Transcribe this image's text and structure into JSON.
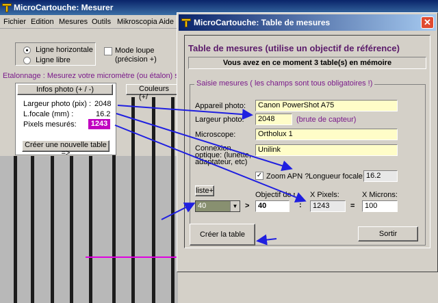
{
  "main_window": {
    "title": "MicroCartouche: Mesurer",
    "menu": [
      "Fichier",
      "Edition",
      "Mesures",
      "Outils",
      "Mikroscopia",
      "Aide"
    ],
    "line_options": {
      "horizontal": "Ligne horizontale",
      "libre": "Ligne libre",
      "selected": "horizontal"
    },
    "loupe_mode": {
      "label_line1": "Mode loupe",
      "label_line2": "(précision +)",
      "checked": false
    },
    "calibration_instruction": "Etalonnage : Mesurez votre micromètre (ou étalon) sur",
    "infos_photo_button": "Infos photo (+ / -)",
    "colors_button": "Couleurs (+/",
    "photo_info": {
      "width_label": "Largeur photo (pix) :",
      "width_value": "2048",
      "focal_label": "L.focale (mm) :",
      "focal_value": "16.2",
      "pixels_label": "Pixels mesurés:",
      "pixels_value": "1243"
    },
    "new_table_button": "Créer une nouvelle table =>"
  },
  "dialog": {
    "title": "MicroCartouche: Table de mesures",
    "close_glyph": "✕",
    "heading": "Table de mesures (utilise un objectif de référence)",
    "memory_status": "Vous avez en ce moment 3 table(s) en mémoire",
    "group_title": "Saisie mesures ( les champs sont tous obligatoires !)",
    "fields": {
      "camera_label": "Appareil photo:",
      "camera_value": "Canon PowerShot A75",
      "width_label": "Largeur photo:",
      "width_value": "2048",
      "width_hint": "(brute de capteur)",
      "microscope_label": "Microscope:",
      "microscope_value": "Ortholux 1",
      "connection_label_1": "Connexion",
      "connection_label_2": "optique: (lunette,",
      "connection_label_3": "adaptateur, etc)",
      "connection_value": "Unilink",
      "zoom_label": "Zoom APN ?",
      "zoom_checked": true,
      "focal_label": "Longueur focale:",
      "focal_value": "16.2"
    },
    "list_button": "liste+",
    "objective_select_value": "40",
    "gt_symbol": ">",
    "objective_label": "Objectif de réf.",
    "objective_value": "40",
    "colon_symbol": ":",
    "xpixels_label": "X Pixels:",
    "xpixels_value": "1243",
    "equals_symbol": "=",
    "xmicrons_label": "X Microns:",
    "xmicrons_value": "100",
    "create_button": "Créer la table",
    "exit_button": "Sortir"
  },
  "colors": {
    "annotation_arrow": "#1f1fe0",
    "magnifier_line": "#e000e0",
    "pixels_highlight": "#c000c0",
    "heading_purple": "#5a1a6a",
    "field_yellow": "#fffdc8"
  }
}
